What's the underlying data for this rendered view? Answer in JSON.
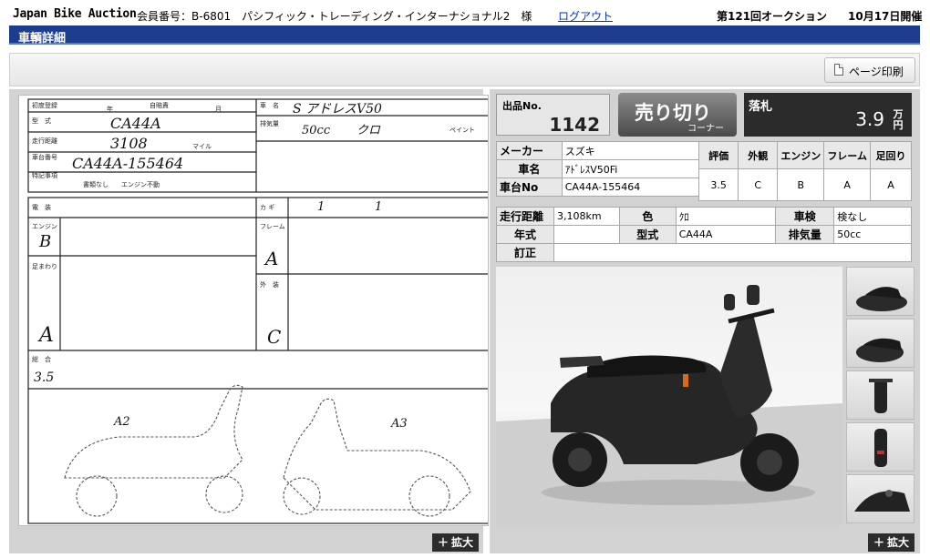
{
  "header": {
    "logo": "Japan Bike Auction",
    "member_info": "会員番号：B-6801　パシフィック・トレーディング・インターナショナル2　様",
    "logout": "ログアウト",
    "auction_no": "第121回オークション",
    "date": "10月17日開催"
  },
  "title": "車輌詳細",
  "toolbar": {
    "print_label": "ページ印刷"
  },
  "zoom_label": "拡大",
  "lot": {
    "label": "出品No.",
    "number": "1142"
  },
  "corner": {
    "main": "売り切り",
    "sub": "コーナー"
  },
  "price": {
    "label": "落札",
    "value": "3.9",
    "unit": "万円"
  },
  "spec": {
    "maker_label": "メーカー",
    "maker": "スズキ",
    "name_label": "車名",
    "name": "ｱﾄﾞﾚｽV50Fi",
    "frame_label": "車台No",
    "frame": "CA44A-155464",
    "mileage_label": "走行距離",
    "mileage": "3,108km",
    "color_label": "色",
    "color": "ｸﾛ",
    "inspection_label": "車検",
    "inspection": "検なし",
    "year_label": "年式",
    "year": "",
    "model_label": "型式",
    "model": "CA44A",
    "displacement_label": "排気量",
    "displacement": "50cc",
    "correction_label": "訂正",
    "correction": ""
  },
  "grades": {
    "headers": [
      "評価",
      "外観",
      "エンジン",
      "フレーム",
      "足回り"
    ],
    "values": [
      "3.5",
      "C",
      "B",
      "A",
      "A"
    ]
  },
  "sheet": {
    "labels": {
      "first_reg": "初度登録",
      "year": "年",
      "month": "月",
      "self_ins": "自賠責",
      "type": "型　式",
      "mileage": "走行距離",
      "mile": "マイル",
      "frame_no": "車台番号",
      "notes": "特記事項",
      "docs": "書類なし　　エンジン不動",
      "car_name": "車　名",
      "displacement": "排気量",
      "paint": "ペイント",
      "electric": "電　装",
      "engine": "エンジン",
      "frame": "フレーム",
      "suspension": "足まわり",
      "exterior": "外　装",
      "key": "カ ギ",
      "overall": "総　合"
    },
    "hand": {
      "car_name": "S アドレスV50",
      "displacement": "50cc",
      "color": "クロ",
      "type": "CA44A",
      "mileage": "3108",
      "frame_no": "CA44A-155464",
      "key": "1",
      "shutter": "1",
      "engine_grade": "B",
      "frame_grade": "A",
      "susp_grade": "A",
      "ext_grade": "C",
      "overall": "3.5",
      "note_a2": "A2",
      "note_a3": "A3"
    }
  }
}
